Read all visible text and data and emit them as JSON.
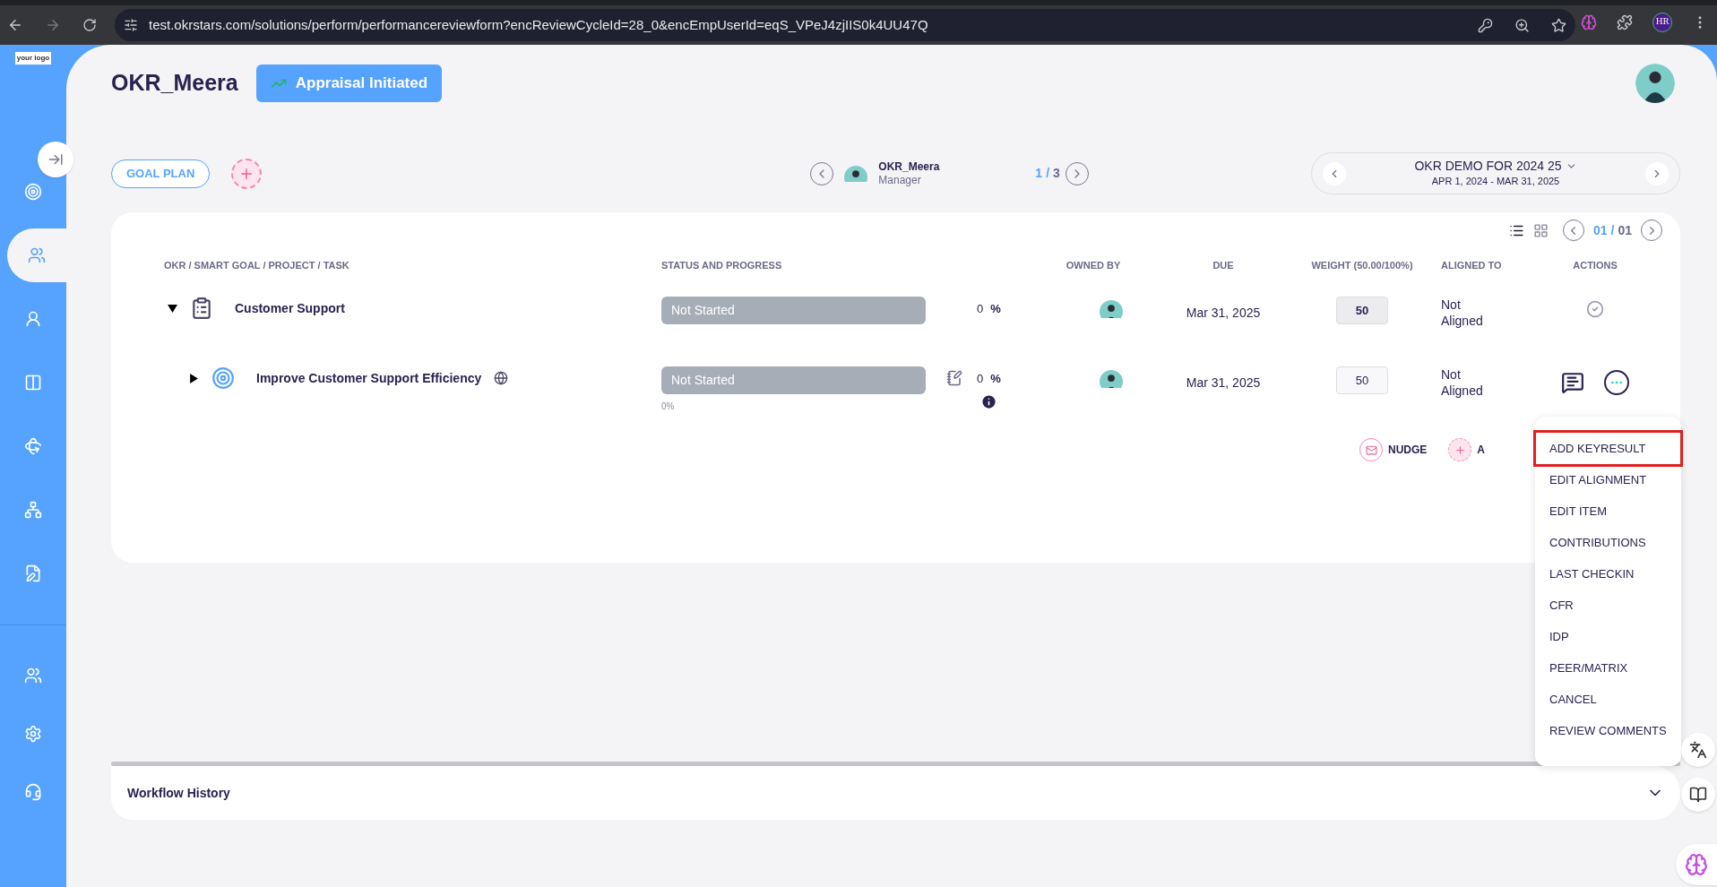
{
  "browser": {
    "url": "test.okrstars.com/solutions/perform/performancereviewform?encReviewCycleId=28_0&encEmpUserId=eqS_VPeJ4zjIIS0k4UU47Q",
    "profile": "HR"
  },
  "sidebar": {
    "logo": "your logo",
    "items": [
      {
        "kind": "target",
        "selected": false
      },
      {
        "kind": "team",
        "selected": true
      },
      {
        "kind": "person",
        "selected": false
      },
      {
        "kind": "card",
        "selected": false
      },
      {
        "kind": "rotate",
        "selected": false
      },
      {
        "kind": "hierarchy",
        "selected": false
      },
      {
        "kind": "document",
        "selected": false
      }
    ],
    "bottom_items": [
      {
        "kind": "group",
        "selected": false
      },
      {
        "kind": "settings",
        "selected": false
      },
      {
        "kind": "support",
        "selected": false
      }
    ]
  },
  "header": {
    "name": "OKR_Meera",
    "status": "Appraisal Initiated"
  },
  "toolbar": {
    "goal_plan": "GOAL PLAN",
    "employee": {
      "name": "OKR_Meera",
      "role": "Manager"
    },
    "page_current": "1",
    "page_separator": "/",
    "page_total": "3",
    "cycle": {
      "title": "OKR DEMO FOR 2024 25",
      "dates": "APR 1, 2024 - MAR 31, 2025"
    }
  },
  "list_controls": {
    "views": [
      {
        "kind": "list",
        "selected": true
      },
      {
        "kind": "grid",
        "selected": false
      }
    ],
    "page_current": "01",
    "page_separator": "/",
    "page_total": "01"
  },
  "table": {
    "columns": [
      "OKR / SMART GOAL / PROJECT / TASK",
      "STATUS AND PROGRESS",
      "OWNED BY",
      "DUE",
      "WEIGHT (50.00/100%)",
      "ALIGNED TO",
      "ACTIONS"
    ],
    "rows": [
      {
        "kind": "objective",
        "expanded": true,
        "title": "Customer Support",
        "status": "Not Started",
        "percent": "0",
        "percent_sign": "%",
        "due": "Mar 31, 2025",
        "weight": "50",
        "editable": false,
        "aligned": "Not Aligned"
      },
      {
        "kind": "goal",
        "expanded": false,
        "title": "Improve Customer Support Efficiency",
        "status": "Not Started",
        "progress_label": "0%",
        "percent": "0",
        "percent_sign": "%",
        "due": "Mar 31, 2025",
        "weight": "50",
        "editable": true,
        "aligned": "Not Aligned"
      }
    ]
  },
  "footer_actions": [
    {
      "kind": "nudge",
      "label": "NUDGE"
    },
    {
      "kind": "add",
      "label": "A"
    }
  ],
  "menu": {
    "items": [
      {
        "label": "ADD KEYRESULT",
        "highlighted": true
      },
      {
        "label": "EDIT ALIGNMENT",
        "highlighted": false
      },
      {
        "label": "EDIT ITEM",
        "highlighted": false
      },
      {
        "label": "CONTRIBUTIONS",
        "highlighted": false
      },
      {
        "label": "LAST CHECKIN",
        "highlighted": false
      },
      {
        "label": "CFR",
        "highlighted": false
      },
      {
        "label": "IDP",
        "highlighted": false
      },
      {
        "label": "PEER/MATRIX",
        "highlighted": false
      },
      {
        "label": "CANCEL",
        "highlighted": false
      },
      {
        "label": "REVIEW COMMENTS",
        "highlighted": false
      }
    ]
  },
  "workflow": {
    "title": "Workflow History",
    "expanded": false
  }
}
